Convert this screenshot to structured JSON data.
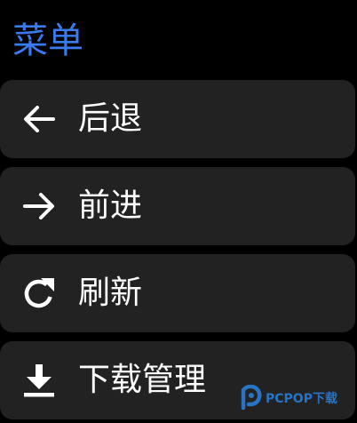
{
  "header": {
    "title": "菜单"
  },
  "menu": {
    "items": [
      {
        "label": "后退",
        "icon": "arrow-left-icon"
      },
      {
        "label": "前进",
        "icon": "arrow-right-icon"
      },
      {
        "label": "刷新",
        "icon": "refresh-icon"
      },
      {
        "label": "下载管理",
        "icon": "download-icon"
      }
    ]
  },
  "watermark": {
    "text": "PCPOP下载"
  },
  "colors": {
    "background": "#000000",
    "title": "#3a7bf0",
    "item_background": "#222222",
    "text": "#ffffff"
  }
}
